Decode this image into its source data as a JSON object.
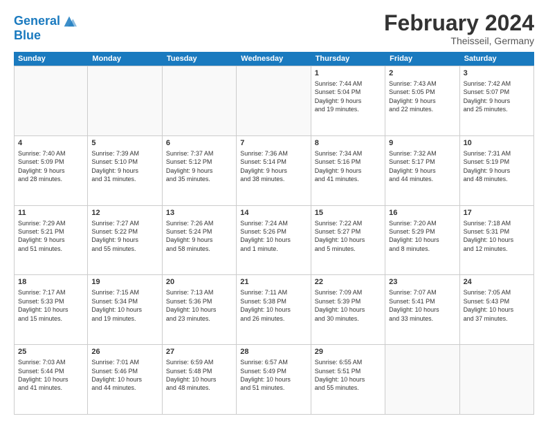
{
  "logo": {
    "line1": "General",
    "line2": "Blue"
  },
  "title": "February 2024",
  "subtitle": "Theisseil, Germany",
  "header_days": [
    "Sunday",
    "Monday",
    "Tuesday",
    "Wednesday",
    "Thursday",
    "Friday",
    "Saturday"
  ],
  "weeks": [
    [
      {
        "day": "",
        "info": ""
      },
      {
        "day": "",
        "info": ""
      },
      {
        "day": "",
        "info": ""
      },
      {
        "day": "",
        "info": ""
      },
      {
        "day": "1",
        "info": "Sunrise: 7:44 AM\nSunset: 5:04 PM\nDaylight: 9 hours\nand 19 minutes."
      },
      {
        "day": "2",
        "info": "Sunrise: 7:43 AM\nSunset: 5:05 PM\nDaylight: 9 hours\nand 22 minutes."
      },
      {
        "day": "3",
        "info": "Sunrise: 7:42 AM\nSunset: 5:07 PM\nDaylight: 9 hours\nand 25 minutes."
      }
    ],
    [
      {
        "day": "4",
        "info": "Sunrise: 7:40 AM\nSunset: 5:09 PM\nDaylight: 9 hours\nand 28 minutes."
      },
      {
        "day": "5",
        "info": "Sunrise: 7:39 AM\nSunset: 5:10 PM\nDaylight: 9 hours\nand 31 minutes."
      },
      {
        "day": "6",
        "info": "Sunrise: 7:37 AM\nSunset: 5:12 PM\nDaylight: 9 hours\nand 35 minutes."
      },
      {
        "day": "7",
        "info": "Sunrise: 7:36 AM\nSunset: 5:14 PM\nDaylight: 9 hours\nand 38 minutes."
      },
      {
        "day": "8",
        "info": "Sunrise: 7:34 AM\nSunset: 5:16 PM\nDaylight: 9 hours\nand 41 minutes."
      },
      {
        "day": "9",
        "info": "Sunrise: 7:32 AM\nSunset: 5:17 PM\nDaylight: 9 hours\nand 44 minutes."
      },
      {
        "day": "10",
        "info": "Sunrise: 7:31 AM\nSunset: 5:19 PM\nDaylight: 9 hours\nand 48 minutes."
      }
    ],
    [
      {
        "day": "11",
        "info": "Sunrise: 7:29 AM\nSunset: 5:21 PM\nDaylight: 9 hours\nand 51 minutes."
      },
      {
        "day": "12",
        "info": "Sunrise: 7:27 AM\nSunset: 5:22 PM\nDaylight: 9 hours\nand 55 minutes."
      },
      {
        "day": "13",
        "info": "Sunrise: 7:26 AM\nSunset: 5:24 PM\nDaylight: 9 hours\nand 58 minutes."
      },
      {
        "day": "14",
        "info": "Sunrise: 7:24 AM\nSunset: 5:26 PM\nDaylight: 10 hours\nand 1 minute."
      },
      {
        "day": "15",
        "info": "Sunrise: 7:22 AM\nSunset: 5:27 PM\nDaylight: 10 hours\nand 5 minutes."
      },
      {
        "day": "16",
        "info": "Sunrise: 7:20 AM\nSunset: 5:29 PM\nDaylight: 10 hours\nand 8 minutes."
      },
      {
        "day": "17",
        "info": "Sunrise: 7:18 AM\nSunset: 5:31 PM\nDaylight: 10 hours\nand 12 minutes."
      }
    ],
    [
      {
        "day": "18",
        "info": "Sunrise: 7:17 AM\nSunset: 5:33 PM\nDaylight: 10 hours\nand 15 minutes."
      },
      {
        "day": "19",
        "info": "Sunrise: 7:15 AM\nSunset: 5:34 PM\nDaylight: 10 hours\nand 19 minutes."
      },
      {
        "day": "20",
        "info": "Sunrise: 7:13 AM\nSunset: 5:36 PM\nDaylight: 10 hours\nand 23 minutes."
      },
      {
        "day": "21",
        "info": "Sunrise: 7:11 AM\nSunset: 5:38 PM\nDaylight: 10 hours\nand 26 minutes."
      },
      {
        "day": "22",
        "info": "Sunrise: 7:09 AM\nSunset: 5:39 PM\nDaylight: 10 hours\nand 30 minutes."
      },
      {
        "day": "23",
        "info": "Sunrise: 7:07 AM\nSunset: 5:41 PM\nDaylight: 10 hours\nand 33 minutes."
      },
      {
        "day": "24",
        "info": "Sunrise: 7:05 AM\nSunset: 5:43 PM\nDaylight: 10 hours\nand 37 minutes."
      }
    ],
    [
      {
        "day": "25",
        "info": "Sunrise: 7:03 AM\nSunset: 5:44 PM\nDaylight: 10 hours\nand 41 minutes."
      },
      {
        "day": "26",
        "info": "Sunrise: 7:01 AM\nSunset: 5:46 PM\nDaylight: 10 hours\nand 44 minutes."
      },
      {
        "day": "27",
        "info": "Sunrise: 6:59 AM\nSunset: 5:48 PM\nDaylight: 10 hours\nand 48 minutes."
      },
      {
        "day": "28",
        "info": "Sunrise: 6:57 AM\nSunset: 5:49 PM\nDaylight: 10 hours\nand 51 minutes."
      },
      {
        "day": "29",
        "info": "Sunrise: 6:55 AM\nSunset: 5:51 PM\nDaylight: 10 hours\nand 55 minutes."
      },
      {
        "day": "",
        "info": ""
      },
      {
        "day": "",
        "info": ""
      }
    ]
  ]
}
